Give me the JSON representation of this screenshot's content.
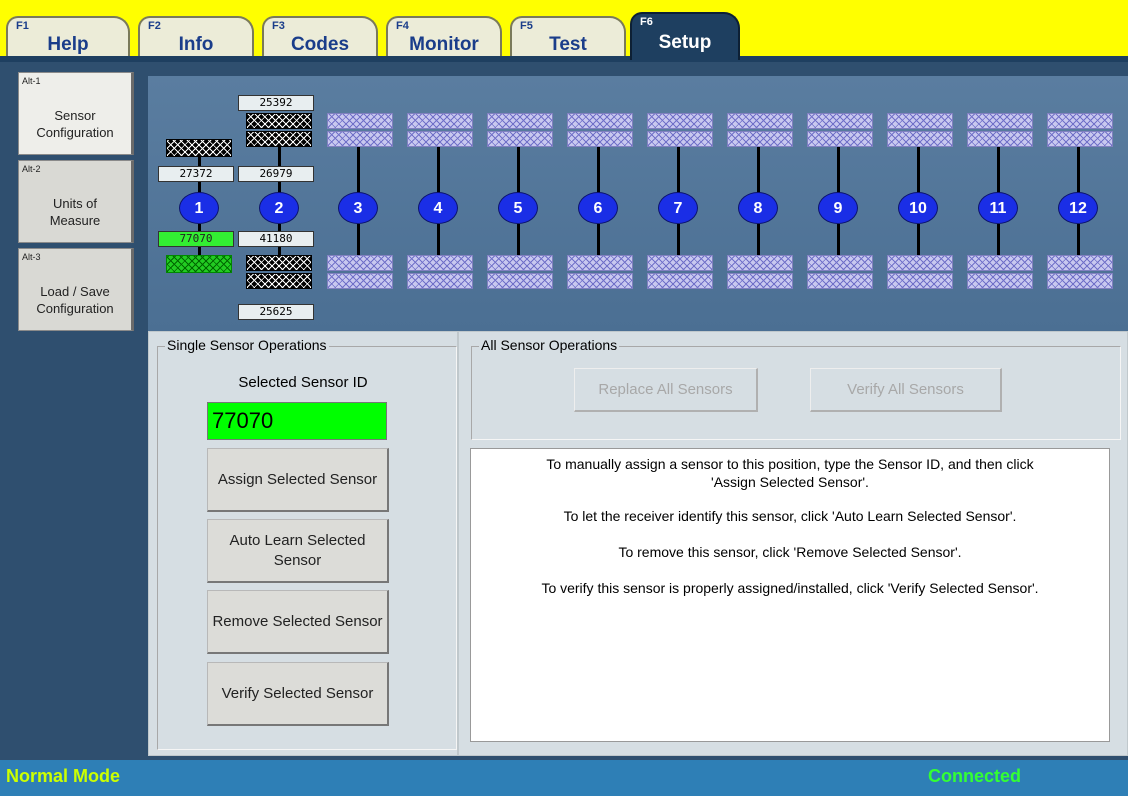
{
  "tabs": [
    {
      "key": "F1",
      "label": "Help"
    },
    {
      "key": "F2",
      "label": "Info"
    },
    {
      "key": "F3",
      "label": "Codes"
    },
    {
      "key": "F4",
      "label": "Monitor"
    },
    {
      "key": "F5",
      "label": "Test"
    },
    {
      "key": "F6",
      "label": "Setup",
      "active": true
    }
  ],
  "sidebar": {
    "items": [
      {
        "alt": "Alt-1",
        "label": "Sensor Configuration",
        "active": true
      },
      {
        "alt": "Alt-2",
        "label": "Units of Measure"
      },
      {
        "alt": "Alt-3",
        "label": "Load / Save Configuration"
      }
    ]
  },
  "sensors": {
    "positions": [
      "1",
      "2",
      "3",
      "4",
      "5",
      "6",
      "7",
      "8",
      "9",
      "10",
      "11",
      "12"
    ],
    "pos1": {
      "upper_id": "27372",
      "lower_id": "77070"
    },
    "pos2": {
      "outer_upper_id": "25392",
      "inner_upper_id": "26979",
      "inner_lower_id": "41180",
      "outer_lower_id": "25625"
    }
  },
  "single_ops": {
    "title": "Single Sensor Operations",
    "selected_label": "Selected Sensor ID",
    "selected_value": "77070",
    "assign_label": "Assign Selected Sensor",
    "auto_learn_label": "Auto Learn Selected Sensor",
    "remove_label": "Remove Selected Sensor",
    "verify_label": "Verify Selected Sensor"
  },
  "all_ops": {
    "title": "All Sensor Operations",
    "replace_label": "Replace All Sensors",
    "verify_label": "Verify All Sensors"
  },
  "instructions": {
    "line1a": "To manually assign a sensor to this position, type the Sensor ID, and then click",
    "line1b": "'Assign Selected Sensor'.",
    "line2": "To let the receiver identify this sensor, click 'Auto Learn Selected Sensor'.",
    "line3": "To remove this sensor, click 'Remove Selected Sensor'.",
    "line4": "To verify this sensor is properly assigned/installed, click 'Verify Selected Sensor'."
  },
  "status": {
    "mode": "Normal Mode",
    "connection": "Connected"
  },
  "colors": {
    "tabbar": "#ffff00",
    "status_mode": "#ccff00",
    "status_connected": "#33ff33",
    "selected_sensor": "#00ff00",
    "position_oval": "#1a2ee6"
  }
}
